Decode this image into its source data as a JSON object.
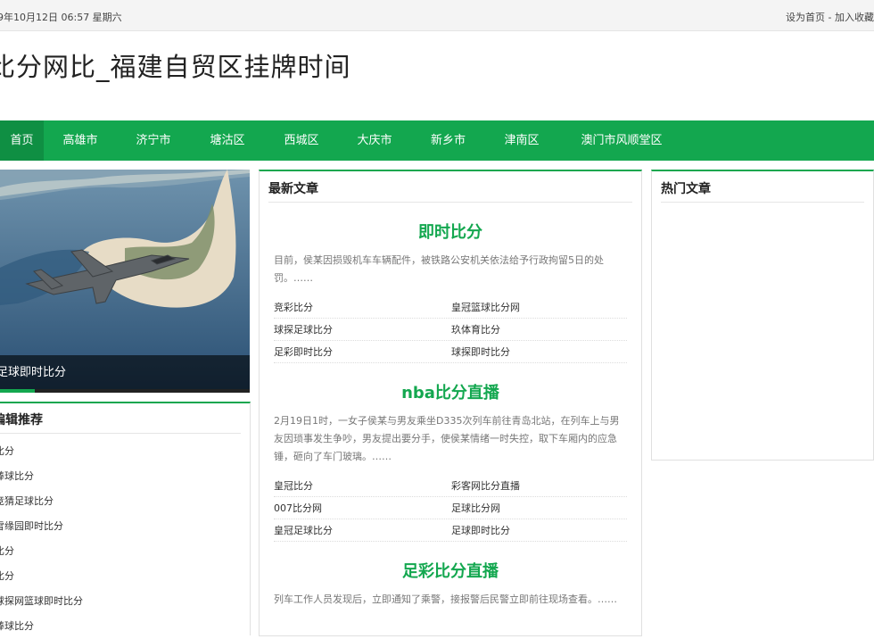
{
  "topbar": {
    "date": "9年10月12日 06:57 星期六",
    "set_home": "设为首页",
    "separator": " - ",
    "bookmark": "加入收藏"
  },
  "site_title": "比分网比_福建自贸区挂牌时间",
  "nav": {
    "items": [
      "首页",
      "高雄市",
      "济宁市",
      "塘沽区",
      "西城区",
      "大庆市",
      "新乡市",
      "津南区",
      "澳门市风顺堂区"
    ],
    "active_index": 0
  },
  "slider": {
    "caption": "足球即时比分",
    "progress": 0.14
  },
  "editor_picks": {
    "heading": "编辑推荐",
    "items": [
      "比分",
      "棒球比分",
      "竞猜足球比分",
      "雪缘园即时比分",
      "比分",
      "比分",
      "球探网篮球即时比分",
      "棒球比分"
    ]
  },
  "latest": {
    "heading": "最新文章",
    "articles": [
      {
        "title": "即时比分",
        "summary": "目前，侯某因损毁机车车辆配件，被铁路公安机关依法给予行政拘留5日的处罚。……",
        "links": [
          [
            "竞彩比分",
            "皇冠篮球比分网"
          ],
          [
            "球探足球比分",
            "玖体育比分"
          ],
          [
            "足彩即时比分",
            "球探即时比分"
          ]
        ]
      },
      {
        "title": "nba比分直播",
        "summary": "2月19日1时，一女子侯某与男友乘坐D335次列车前往青岛北站，在列车上与男友因琐事发生争吵，男友提出要分手，使侯某情绪一时失控，取下车厢内的应急锤，砸向了车门玻璃。……",
        "links": [
          [
            "皇冠比分",
            "彩客网比分直播"
          ],
          [
            "007比分网",
            "足球比分网"
          ],
          [
            "皇冠足球比分",
            "足球即时比分"
          ]
        ]
      },
      {
        "title": "足彩比分直播",
        "summary": "列车工作人员发现后，立即通知了乘警，接报警后民警立即前往现场查看。……",
        "links": []
      }
    ]
  },
  "hot": {
    "heading": "热门文章"
  },
  "colors": {
    "brand": "#13a74f",
    "brand_dark": "#0f8f43"
  }
}
